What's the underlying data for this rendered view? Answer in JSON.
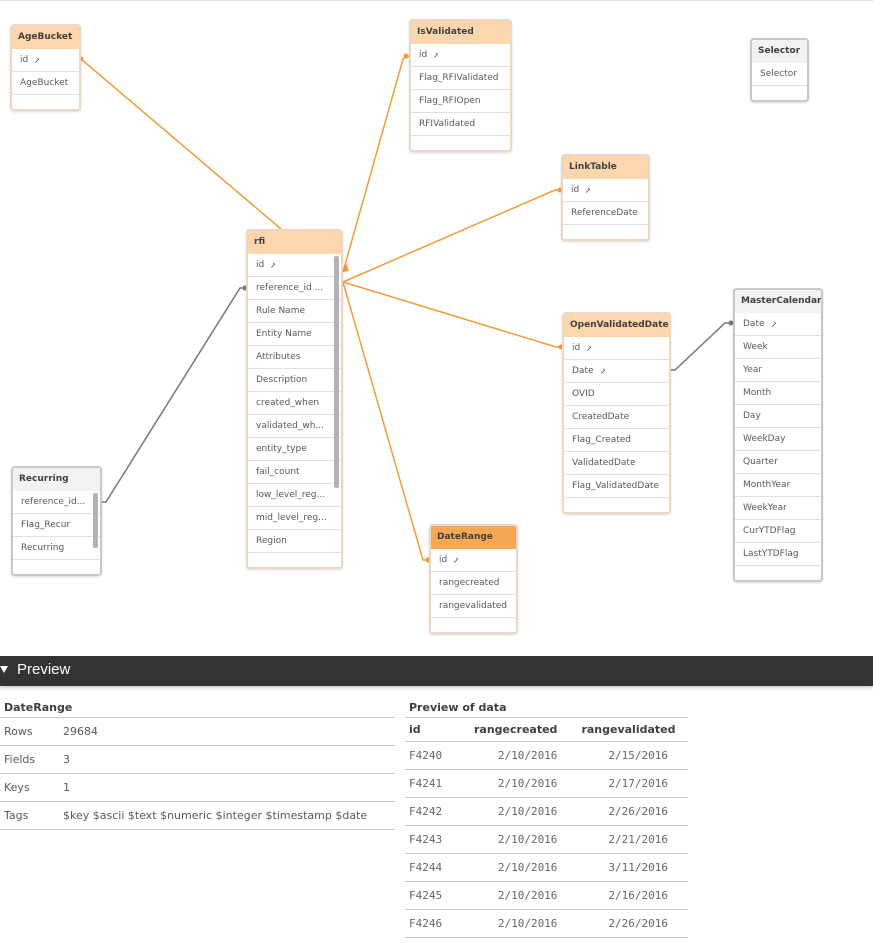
{
  "colors": {
    "link_orange": "#f29b3b",
    "link_gray": "#777777",
    "header_orange": "#fdd6ad",
    "header_selected": "#f7a855",
    "preview_bar": "#333333"
  },
  "key_icon": "key-icon",
  "tables": {
    "agebucket": {
      "name": "AgeBucket",
      "fields": [
        "id",
        "AgeBucket"
      ],
      "keys": [
        true,
        false
      ]
    },
    "isvalidated": {
      "name": "IsValidated",
      "fields": [
        "id",
        "Flag_RFIValidated",
        "Flag_RFIOpen",
        "RFIValidated"
      ],
      "keys": [
        true,
        false,
        false,
        false
      ]
    },
    "selector": {
      "name": "Selector",
      "fields": [
        "Selector"
      ],
      "keys": [
        false
      ]
    },
    "linktable": {
      "name": "LinkTable",
      "fields": [
        "id",
        "ReferenceDate"
      ],
      "keys": [
        true,
        false
      ]
    },
    "rfi": {
      "name": "rfi",
      "fields": [
        "id",
        "reference_id ...",
        "Rule Name",
        "Entity Name",
        "Attributes",
        "Description",
        "created_when",
        "validated_wh...",
        "entity_type",
        "fail_count",
        "low_level_reg...",
        "mid_level_reg...",
        "Region"
      ],
      "keys": [
        true,
        false,
        false,
        false,
        false,
        false,
        false,
        false,
        false,
        false,
        false,
        false,
        false
      ]
    },
    "openvalidateddate": {
      "name": "OpenValidatedDate",
      "fields": [
        "id",
        "Date",
        "OVID",
        "CreatedDate",
        "Flag_Created",
        "ValidatedDate",
        "Flag_ValidatedDate"
      ],
      "keys": [
        true,
        true,
        false,
        false,
        false,
        false,
        false
      ]
    },
    "mastercalendar": {
      "name": "MasterCalendar",
      "fields": [
        "Date",
        "Week",
        "Year",
        "Month",
        "Day",
        "WeekDay",
        "Quarter",
        "MonthYear",
        "WeekYear",
        "CurYTDFlag",
        "LastYTDFlag"
      ],
      "keys": [
        true,
        false,
        false,
        false,
        false,
        false,
        false,
        false,
        false,
        false,
        false
      ]
    },
    "recurring": {
      "name": "Recurring",
      "fields": [
        "reference_id...",
        "Flag_Recur",
        "Recurring"
      ],
      "keys": [
        false,
        false,
        false
      ]
    },
    "daterange": {
      "name": "DateRange",
      "fields": [
        "id",
        "rangecreated",
        "rangevalidated"
      ],
      "keys": [
        true,
        false,
        false
      ]
    }
  },
  "preview": {
    "title": "Preview",
    "table_name": "DateRange",
    "meta": [
      {
        "label": "Rows",
        "value": "29684"
      },
      {
        "label": "Fields",
        "value": "3"
      },
      {
        "label": "Keys",
        "value": "1"
      },
      {
        "label": "Tags",
        "value": "$key $ascii $text $numeric $integer $timestamp $date"
      }
    ],
    "data_title": "Preview of data",
    "columns": [
      "id",
      "rangecreated",
      "rangevalidated"
    ],
    "rows": [
      [
        "F4240",
        "2/10/2016",
        "2/15/2016"
      ],
      [
        "F4241",
        "2/10/2016",
        "2/17/2016"
      ],
      [
        "F4242",
        "2/10/2016",
        "2/26/2016"
      ],
      [
        "F4243",
        "2/10/2016",
        "2/21/2016"
      ],
      [
        "F4244",
        "2/10/2016",
        "3/11/2016"
      ],
      [
        "F4245",
        "2/10/2016",
        "2/16/2016"
      ],
      [
        "F4246",
        "2/10/2016",
        "2/26/2016"
      ]
    ]
  }
}
